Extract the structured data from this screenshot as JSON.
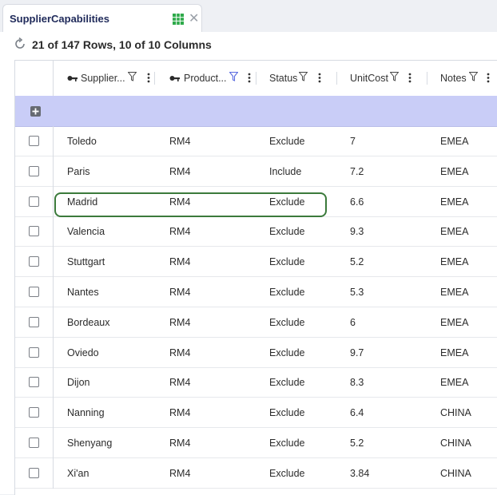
{
  "tab": {
    "title": "SupplierCapabilities",
    "close_label": "✕"
  },
  "toolbar": {
    "row_summary": "21 of 147 Rows, 10 of 10 Columns"
  },
  "columns": [
    {
      "label": "Supplier...",
      "key": true,
      "filter_active": false
    },
    {
      "label": "Product...",
      "key": true,
      "filter_active": true
    },
    {
      "label": "Status",
      "key": false,
      "filter_active": false
    },
    {
      "label": "UnitCost",
      "key": false,
      "filter_active": false
    },
    {
      "label": "Notes",
      "key": false,
      "filter_active": false
    }
  ],
  "rows": [
    {
      "supplier": "Toledo",
      "product": "RM4",
      "status": "Exclude",
      "unitcost": "7",
      "notes": "EMEA"
    },
    {
      "supplier": "Paris",
      "product": "RM4",
      "status": "Include",
      "unitcost": "7.2",
      "notes": "EMEA"
    },
    {
      "supplier": "Madrid",
      "product": "RM4",
      "status": "Exclude",
      "unitcost": "6.6",
      "notes": "EMEA"
    },
    {
      "supplier": "Valencia",
      "product": "RM4",
      "status": "Exclude",
      "unitcost": "9.3",
      "notes": "EMEA"
    },
    {
      "supplier": "Stuttgart",
      "product": "RM4",
      "status": "Exclude",
      "unitcost": "5.2",
      "notes": "EMEA"
    },
    {
      "supplier": "Nantes",
      "product": "RM4",
      "status": "Exclude",
      "unitcost": "5.3",
      "notes": "EMEA"
    },
    {
      "supplier": "Bordeaux",
      "product": "RM4",
      "status": "Exclude",
      "unitcost": "6",
      "notes": "EMEA"
    },
    {
      "supplier": "Oviedo",
      "product": "RM4",
      "status": "Exclude",
      "unitcost": "9.7",
      "notes": "EMEA"
    },
    {
      "supplier": "Dijon",
      "product": "RM4",
      "status": "Exclude",
      "unitcost": "8.3",
      "notes": "EMEA"
    },
    {
      "supplier": "Nanning",
      "product": "RM4",
      "status": "Exclude",
      "unitcost": "6.4",
      "notes": "CHINA"
    },
    {
      "supplier": "Shenyang",
      "product": "RM4",
      "status": "Exclude",
      "unitcost": "5.2",
      "notes": "CHINA"
    },
    {
      "supplier": "Xi'an",
      "product": "RM4",
      "status": "Exclude",
      "unitcost": "3.84",
      "notes": "CHINA"
    }
  ],
  "colors": {
    "accent": "#1f2a5a",
    "add_row_bg": "#c9cdf7",
    "highlight": "#3b7a3b",
    "grid_icon": "#2eaa4a"
  }
}
